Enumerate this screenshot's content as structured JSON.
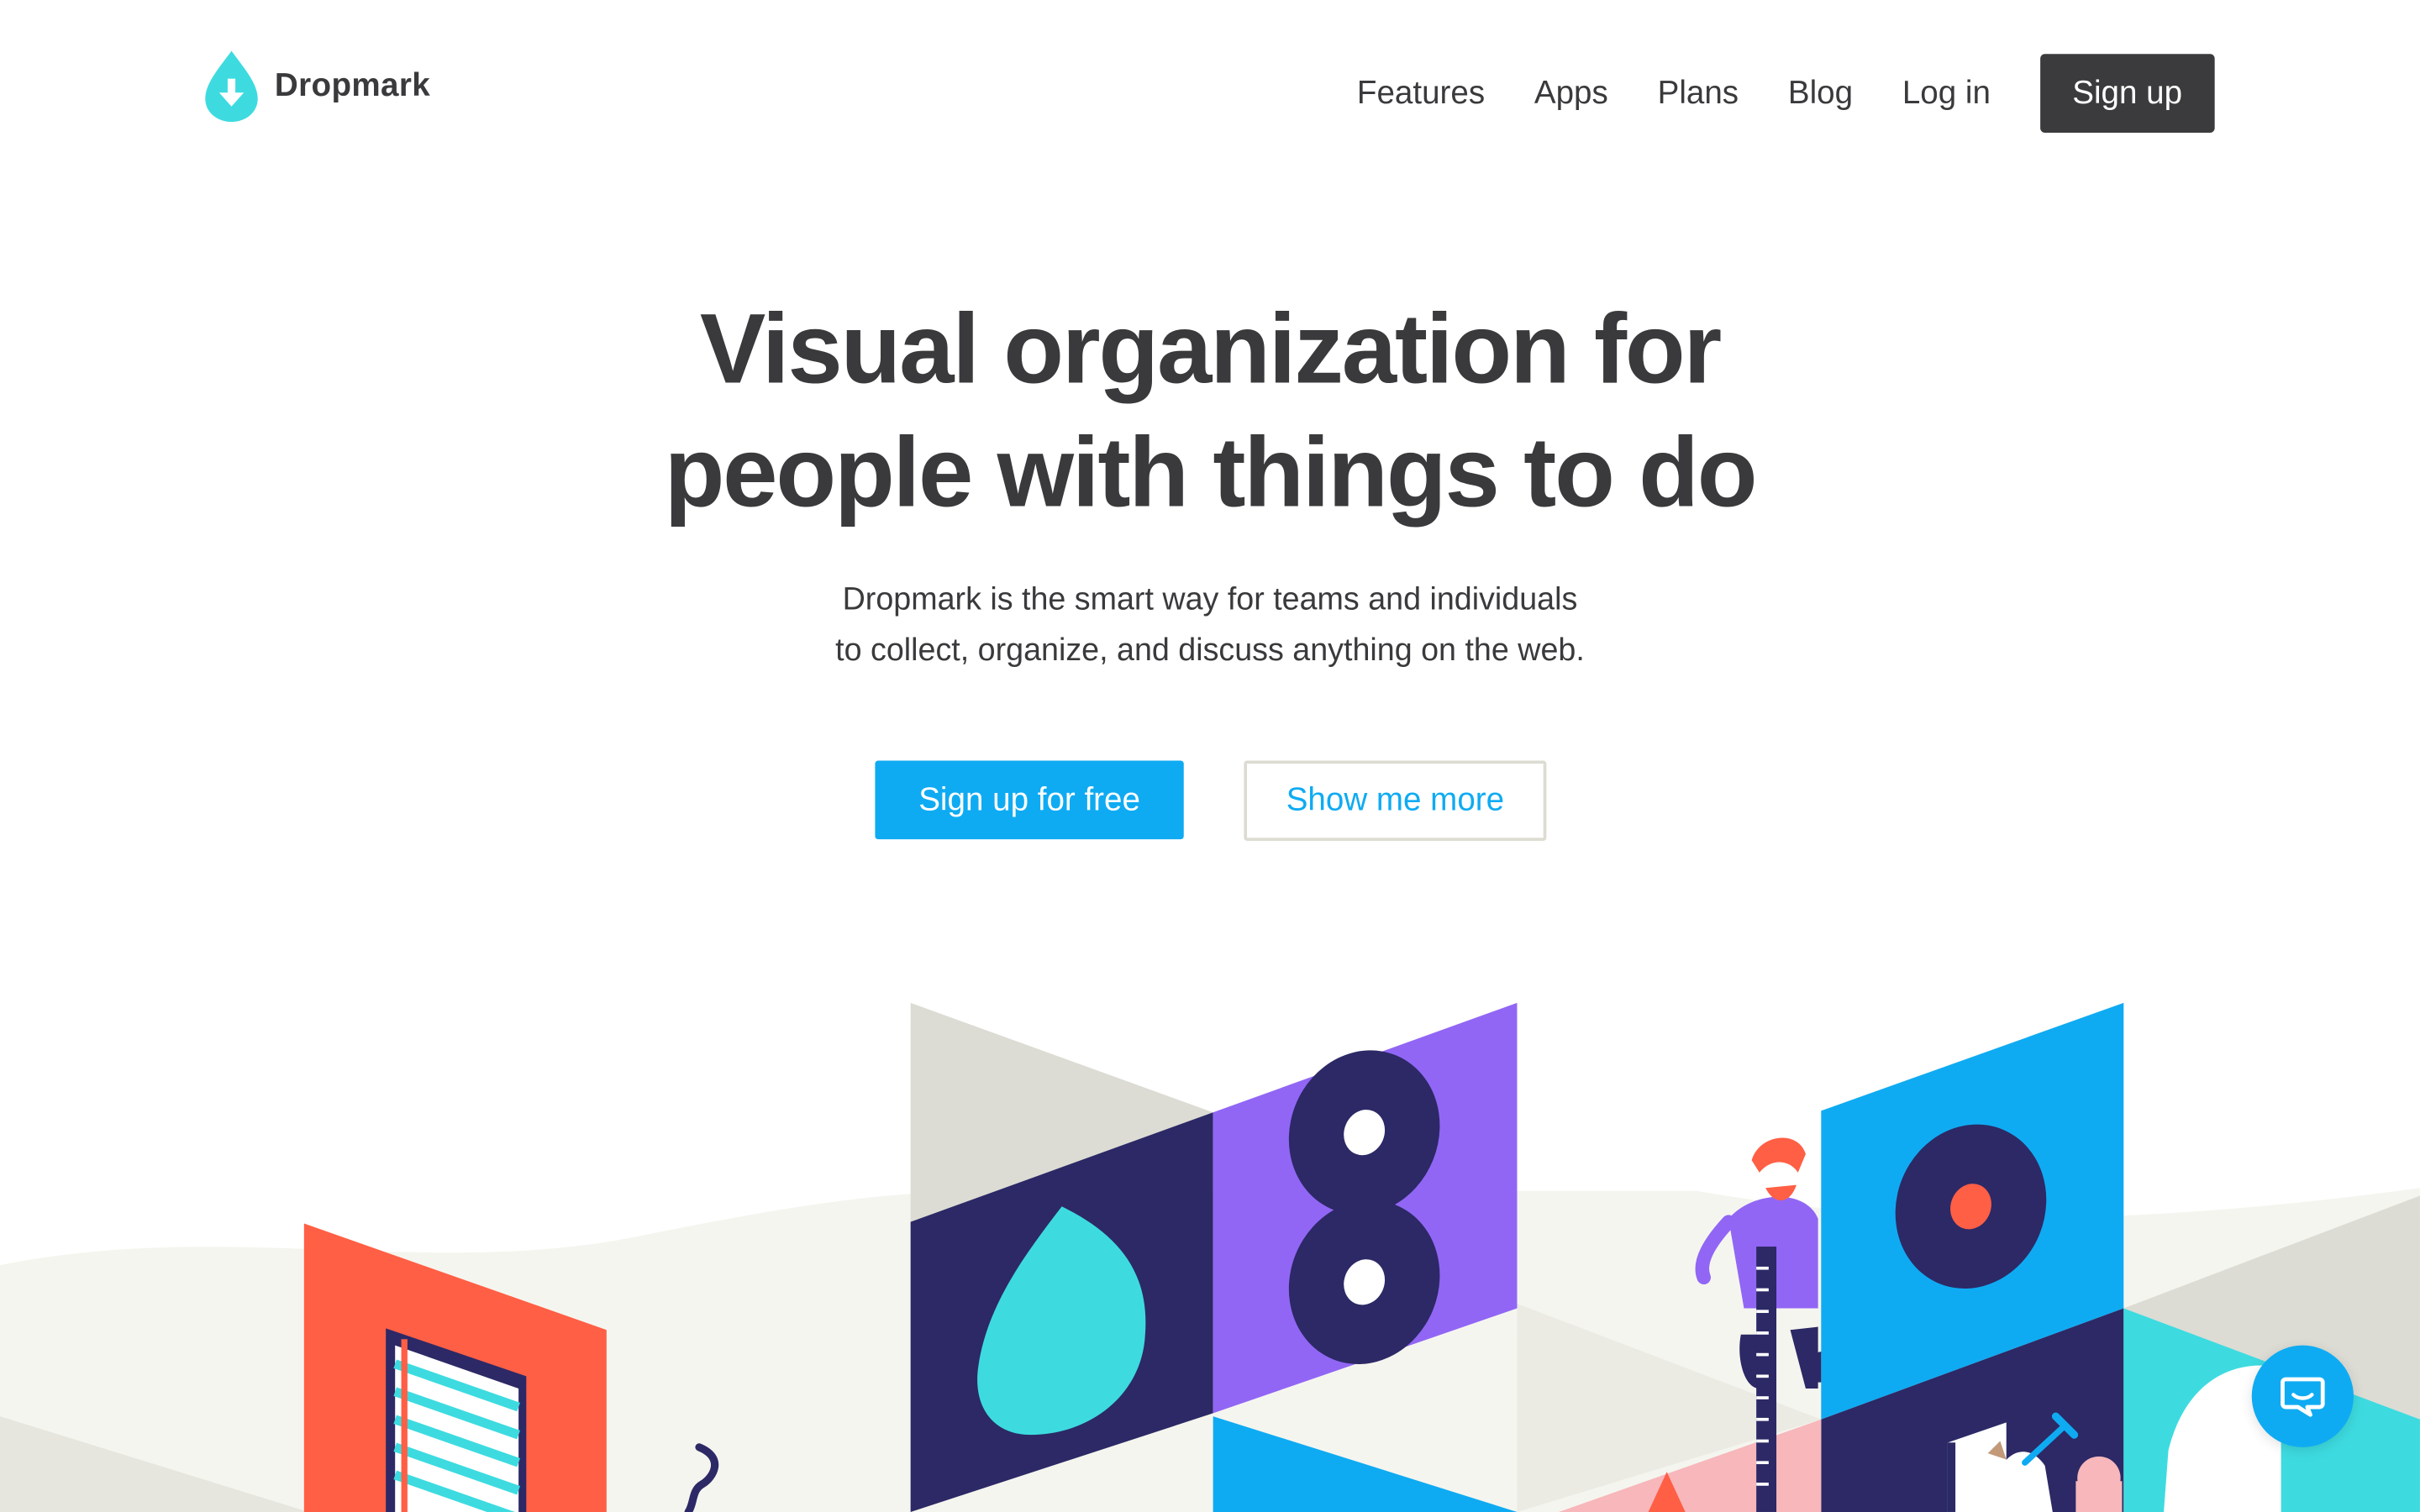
{
  "brand": {
    "name": "Dropmark",
    "logo_icon": "droplet-download-icon",
    "logo_color": "#3ddbe0"
  },
  "nav": {
    "links": [
      "Features",
      "Apps",
      "Plans",
      "Blog",
      "Log in"
    ],
    "signup_label": "Sign up"
  },
  "hero": {
    "title_lines": [
      "Visual organization for",
      "people with things to do"
    ],
    "subtitle_lines": [
      "Dropmark is the smart way for teams and individuals",
      "to collect, organize, and discuss anything on the web."
    ],
    "primary_cta": "Sign up for free",
    "secondary_cta": "Show me more"
  },
  "chat": {
    "icon": "chat-bubble-icon"
  },
  "colors": {
    "accent_blue": "#0fabf2",
    "cyan": "#3ddbe0",
    "navy": "#2c2966",
    "purple": "#9166f5",
    "coral": "#ff5f45",
    "gray": "#dcdcd4",
    "text_dark": "#3a3a3c"
  }
}
